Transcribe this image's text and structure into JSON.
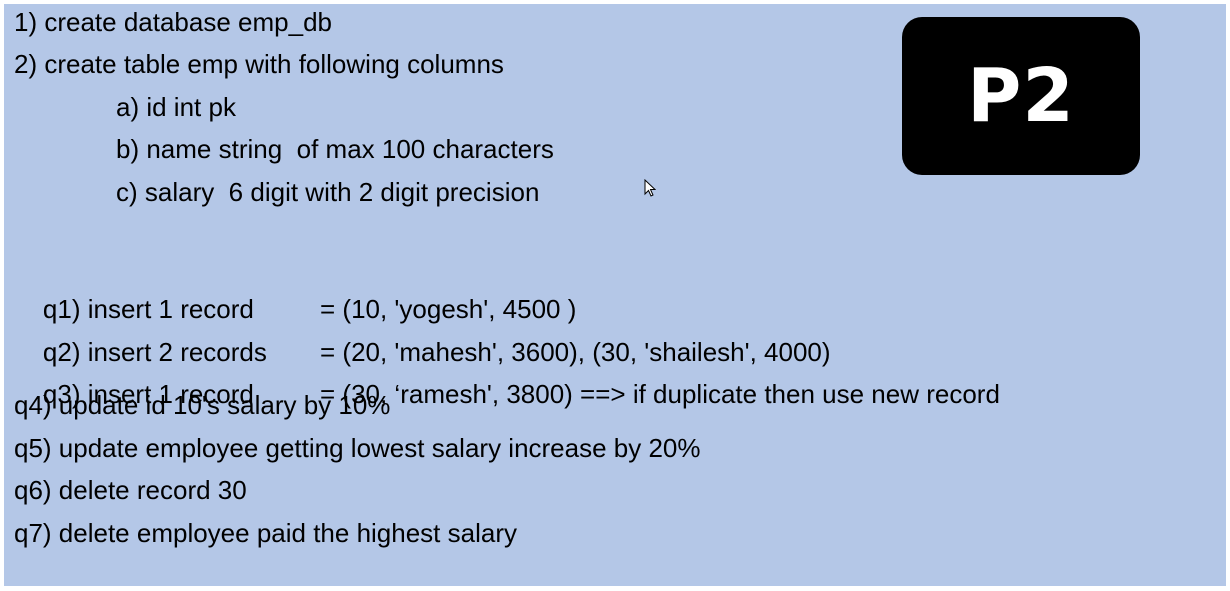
{
  "badge": "P2",
  "lines": {
    "l1": "1) create database emp_db",
    "l2": "2) create table emp with following columns",
    "a": "a) id int pk",
    "b": "b) name string  of max 100 characters",
    "c": "c) salary  6 digit with 2 digit precision"
  },
  "queries": {
    "q1_label": "q1) insert 1 record",
    "q1_value": "= (10, 'yogesh', 4500 )",
    "q2_label": "q2) insert 2 records",
    "q2_value": "= (20, 'mahesh', 3600), (30, 'shailesh', 4000)",
    "q3_label": "q3) insert 1 record",
    "q3_value": "= (30, ‘ramesh', 3800) ==> if duplicate then use new record",
    "q4": "q4) update id 10's salary by 10%",
    "q5": "q5) update employee getting lowest salary increase by 20%",
    "q6": "q6) delete record 30",
    "q7": "q7) delete employee paid the highest salary"
  },
  "icons": {
    "cursor": "mouse-pointer-icon"
  }
}
